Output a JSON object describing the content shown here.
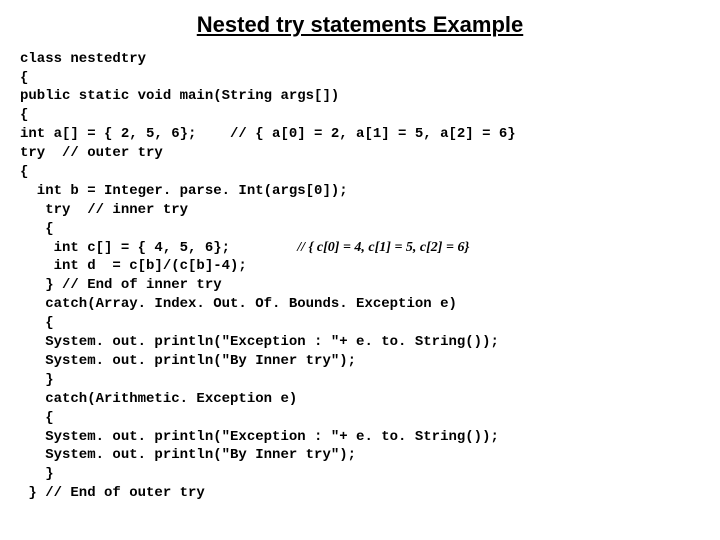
{
  "title": "Nested try statements Example",
  "code": {
    "l1": "class nestedtry",
    "l2": "{",
    "l3": "public static void main(String args[])",
    "l4": "{",
    "l5": "int a[] = { 2, 5, 6};    // { a[0] = 2, a[1] = 5, a[2] = 6}",
    "l6": "try  // outer try",
    "l7": "{",
    "l8": "  int b = Integer. parse. Int(args[0]);",
    "l9": "   try  // inner try",
    "l10": "   {",
    "l11a": "    int c[] = { 4, 5, 6};        ",
    "l11b": "// { c[0] = 4, c[1] = 5, c[2] = 6}",
    "l12": "    int d  = c[b]/(c[b]-4);",
    "l13": "   } // End of inner try",
    "l14": "   catch(Array. Index. Out. Of. Bounds. Exception e)",
    "l15": "   {",
    "l16": "   System. out. println(\"Exception : \"+ e. to. String());",
    "l17": "   System. out. println(\"By Inner try\");",
    "l18": "   }",
    "l19": "   catch(Arithmetic. Exception e)",
    "l20": "   {",
    "l21": "   System. out. println(\"Exception : \"+ e. to. String());",
    "l22": "   System. out. println(\"By Inner try\");",
    "l23": "   }",
    "l24": " } // End of outer try"
  }
}
